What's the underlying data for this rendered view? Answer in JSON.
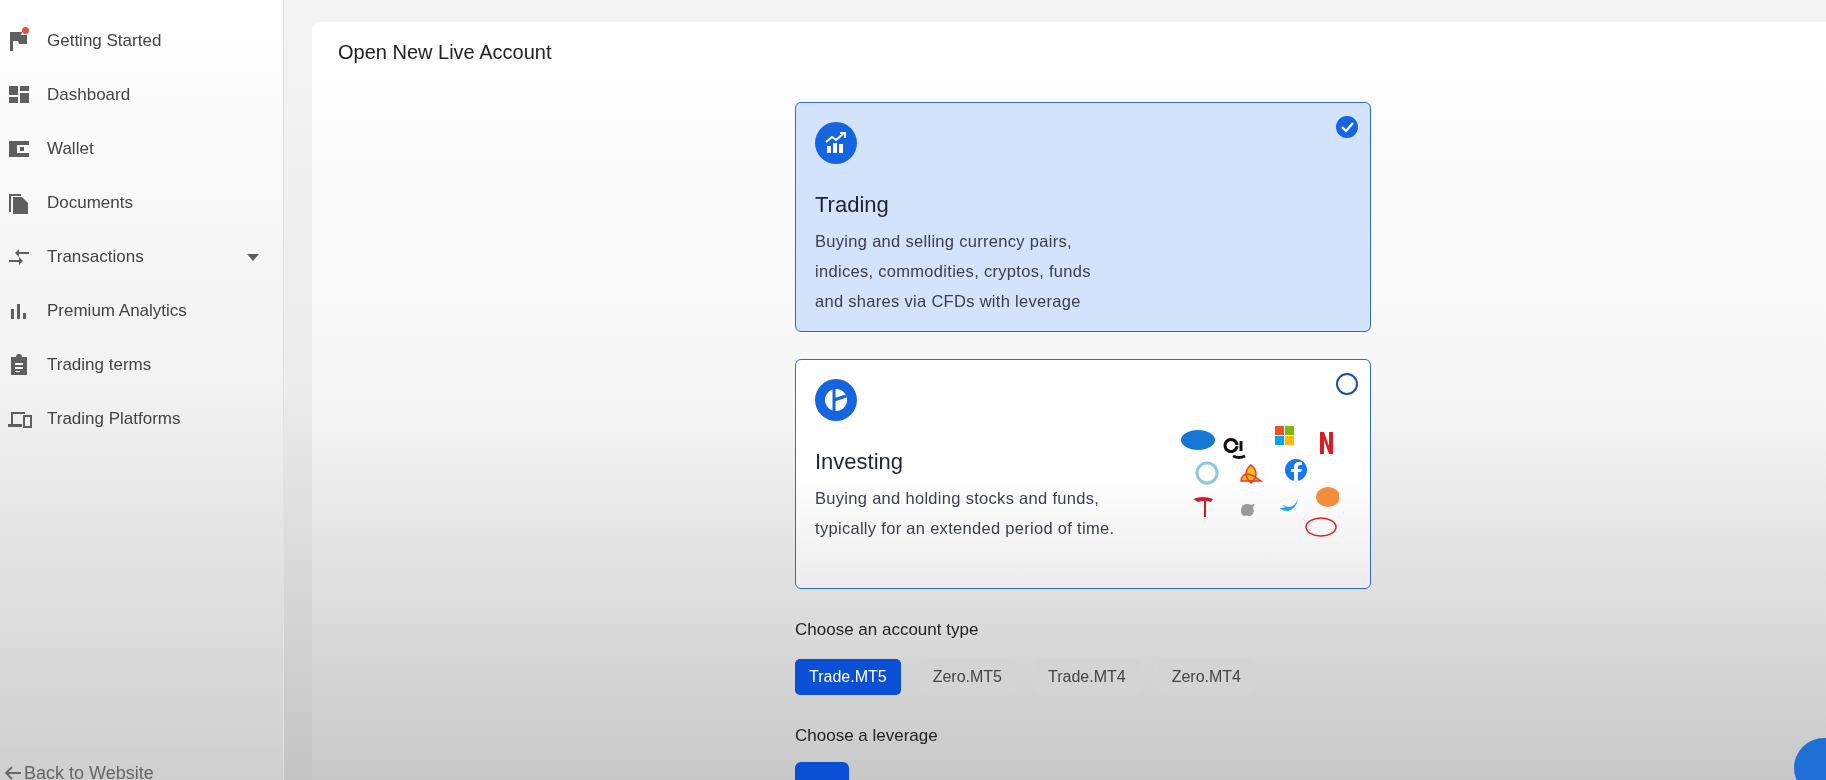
{
  "sidebar": {
    "items": [
      {
        "kind": "flag",
        "label": "Getting Started",
        "notification": true,
        "expandable": false
      },
      {
        "kind": "dashboard",
        "label": "Dashboard",
        "notification": false,
        "expandable": false
      },
      {
        "kind": "wallet",
        "label": "Wallet",
        "notification": false,
        "expandable": false
      },
      {
        "kind": "documents",
        "label": "Documents",
        "notification": false,
        "expandable": false
      },
      {
        "kind": "transactions",
        "label": "Transactions",
        "notification": false,
        "expandable": true
      },
      {
        "kind": "analytics",
        "label": "Premium Analytics",
        "notification": false,
        "expandable": false
      },
      {
        "kind": "terms",
        "label": "Trading terms",
        "notification": false,
        "expandable": false
      },
      {
        "kind": "platforms",
        "label": "Trading Platforms",
        "notification": false,
        "expandable": false
      }
    ],
    "back_link": "Back to Website"
  },
  "page": {
    "title": "Open New Live Account",
    "options": [
      {
        "kind": "trading",
        "title": "Trading",
        "description": "Buying and selling currency pairs, indices, commodities, cryptos, funds and shares via CFDs with leverage",
        "selected": true
      },
      {
        "kind": "investing",
        "title": "Investing",
        "description": "Buying and holding stocks and funds, typically for an extended period of time.",
        "selected": false
      }
    ],
    "account_type_label": "Choose an account type",
    "account_types": [
      {
        "label": "Trade.MT5",
        "selected": true
      },
      {
        "label": "Zero.MT5",
        "selected": false
      },
      {
        "label": "Trade.MT4",
        "selected": false
      },
      {
        "label": "Zero.MT4",
        "selected": false
      }
    ],
    "leverage_label": "Choose a leverage"
  }
}
